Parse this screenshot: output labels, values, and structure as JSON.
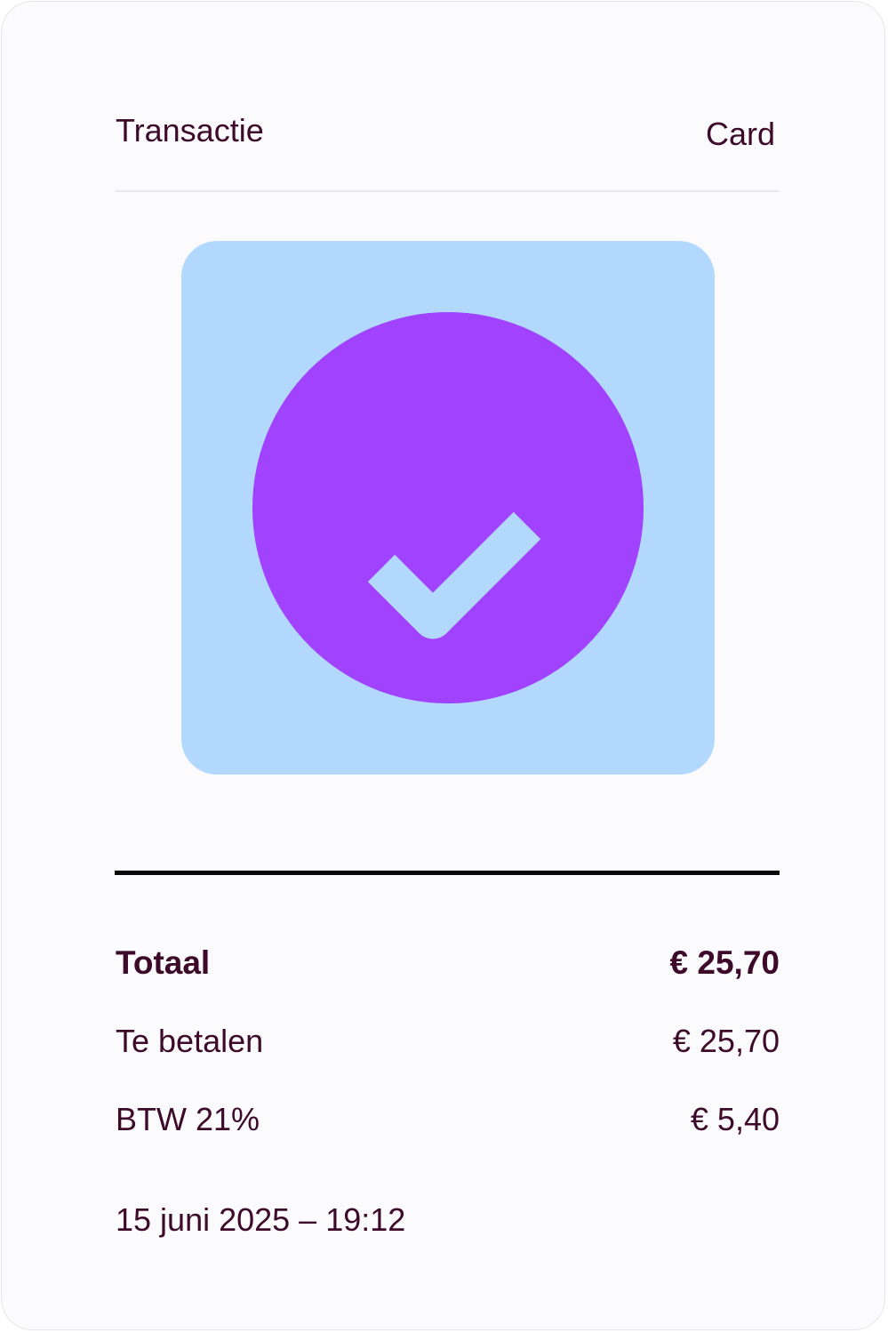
{
  "header": {
    "title": "Transactie",
    "method": "Card"
  },
  "status": {
    "icon": "check-circle-icon",
    "tile_color": "#b3d8fd",
    "circle_color": "#a142fe"
  },
  "summary": {
    "total_label": "Totaal",
    "total_value": "€ 25,70",
    "to_pay_label": "Te betalen",
    "to_pay_value": "€ 25,70",
    "vat_label": "BTW 21%",
    "vat_value": "€ 5,40"
  },
  "timestamp": "15 juni 2025 – 19:12",
  "colors": {
    "text": "#3d0a2a",
    "accent": "#a142fe",
    "tile": "#b3d8fd"
  }
}
